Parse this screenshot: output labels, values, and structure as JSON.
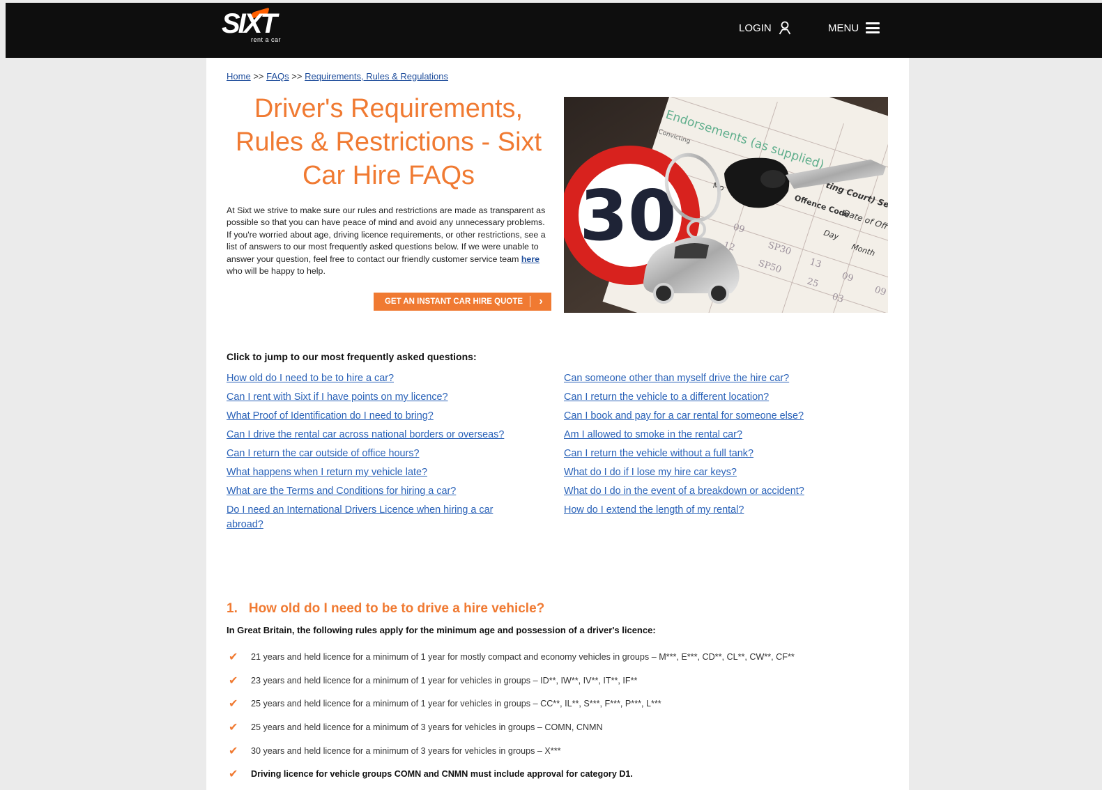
{
  "header": {
    "logo_text": "SIXT",
    "logo_sub": "rent a car",
    "login_label": "LOGIN",
    "menu_label": "MENU"
  },
  "breadcrumb": {
    "home": "Home",
    "sep1": ">>",
    "faqs": "FAQs",
    "sep2": ">>",
    "current": "Requirements, Rules & Regulations"
  },
  "page": {
    "title": "Driver's Requirements, Rules & Restrictions - Sixt Car Hire FAQs",
    "intro_before": "At Sixt we strive to make sure our rules and restrictions are made as transparent as possible so that you can have peace of mind and avoid any unnecessary problems. If you're worried about age, driving licence requirements, or other restrictions, see a list of answers to our most frequently asked questions below. If we were unable to answer your question, feel free to contact our friendly customer service team ",
    "intro_link": "here ",
    "intro_after": "who will be happy to help.",
    "quote_button": "GET AN INSTANT CAR HIRE QUOTE",
    "hero_text": {
      "endorsements": "Endorsements (as supplied)",
      "convicting": "Convicting",
      "court": "ting Court) Sec",
      "date": "Date of Off",
      "offence_code": "Offence Code",
      "day": "Day",
      "month": "Month",
      "sp30a": "SP30",
      "sp30b": "SP50",
      "n09": "09",
      "n12": "12",
      "n13": "13",
      "n25": "25",
      "n09b": "09",
      "n03": "03",
      "n09c": "09",
      "mo": "Mo",
      "sign": "30"
    }
  },
  "faq": {
    "heading": "Click to jump to our most frequently asked questions:",
    "left": [
      "How old do I need to be to hire a car?",
      "Can I rent with Sixt if I have points on my licence?",
      "What Proof of Identification do I need to bring?",
      "Can I drive the rental car across national borders or overseas?",
      "Can I return the car outside of office hours?",
      "What happens when I return my vehicle late?",
      "What are the Terms and Conditions for hiring a car?",
      "Do I need an International Drivers Licence when hiring a car abroad?"
    ],
    "right": [
      "Can someone other than myself drive the hire car?",
      "Can I return the vehicle to a different location?",
      "Can I book and pay for a car rental for someone else?",
      "Am I allowed to smoke in the rental car?",
      "Can I return the vehicle without a full tank?",
      "What do I do if I lose my hire car keys?",
      "What do I do in the event of a breakdown or accident?",
      "How do I extend the length of my rental?"
    ]
  },
  "section1": {
    "number": "1.",
    "title": "How old do I need to be to drive a hire vehicle?",
    "subtitle": "In Great Britain, the following rules apply for the minimum age and possession of a driver's licence:",
    "rules": [
      "21 years and held licence for a minimum of 1 year for mostly compact and economy vehicles in groups – M***, E***, CD**, CL**, CW**, CF**",
      "23 years and held licence for a minimum of 1 year for vehicles in groups – ID**, IW**, IV**, IT**, IF**",
      "25 years and held licence for a minimum of 1 year for vehicles in groups – CC**, IL**, S***, F***, P***, L***",
      "25 years and held licence for a minimum of 3 years for vehicles in groups – COMN, CNMN",
      "30 years and held licence for a minimum of 3 years for vehicles in groups – X***",
      "Driving licence for vehicle groups COMN and CNMN must include approval for category D1."
    ]
  },
  "colors": {
    "accent": "#f07a32",
    "header_bg": "#0e0e0e",
    "link": "#2a62b8"
  }
}
